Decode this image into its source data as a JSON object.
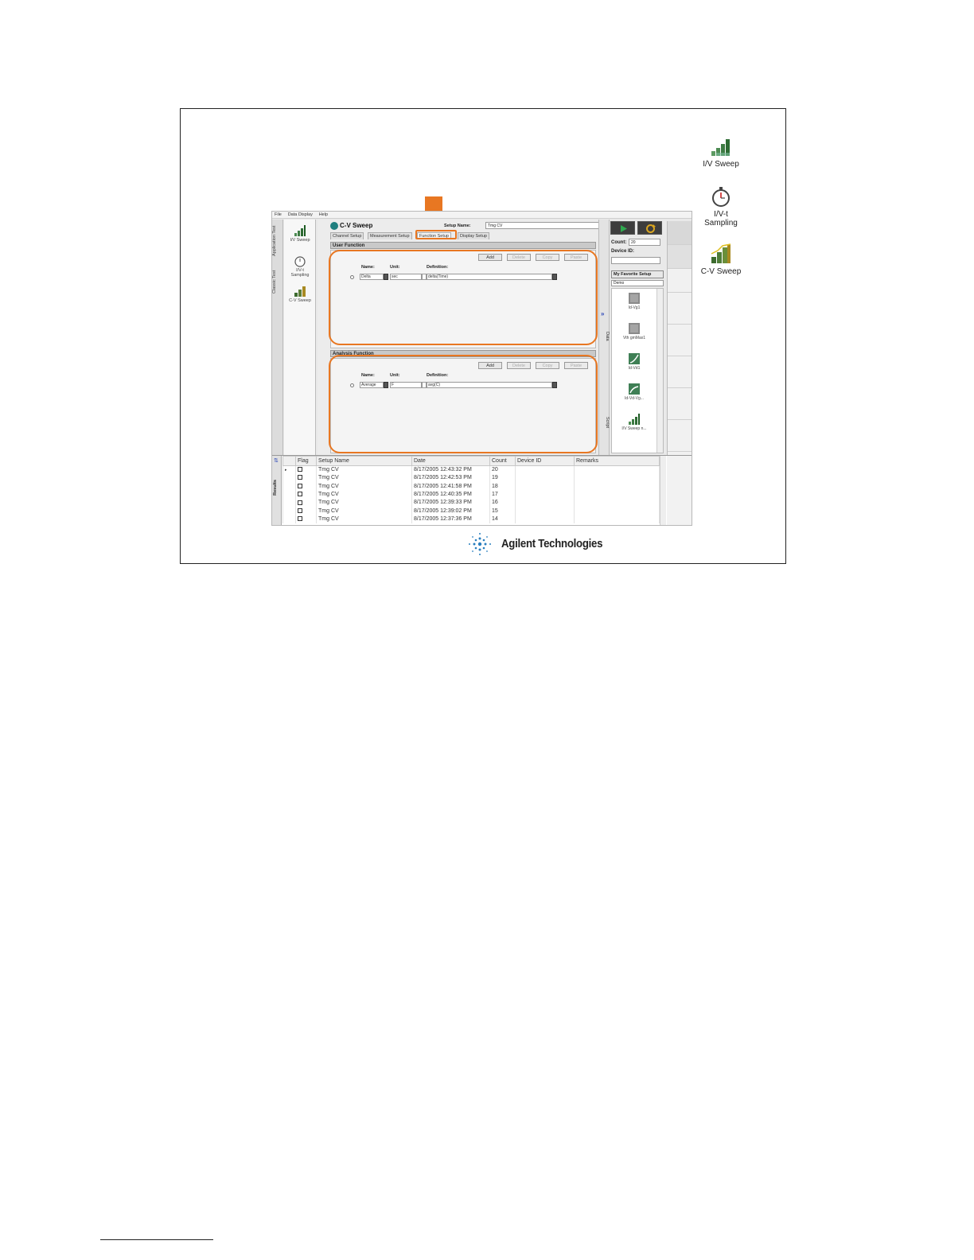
{
  "desktop_icons": [
    {
      "label": "I/V Sweep",
      "icon": "iv-sweep-icon"
    },
    {
      "label": "I/V-t Sampling",
      "icon": "stopwatch-icon"
    },
    {
      "label": "C-V Sweep",
      "icon": "cv-sweep-icon"
    }
  ],
  "menu": [
    "File",
    "Data Display",
    "Help"
  ],
  "vertical_tabs": [
    "Application Test",
    "Classic Test"
  ],
  "nav_items": [
    {
      "label": "I/V Sweep"
    },
    {
      "label": "I/V-t Sampling"
    },
    {
      "label": "C-V Sweep"
    }
  ],
  "header": {
    "title": "C-V Sweep",
    "setup_name_label": "Setup Name:",
    "setup_name_value": "Tmg CV"
  },
  "tabs": [
    {
      "label": "Channel Setup",
      "active": false
    },
    {
      "label": "Measurement Setup",
      "active": false
    },
    {
      "label": "Function Setup",
      "active": true
    },
    {
      "label": "Display Setup",
      "active": false
    }
  ],
  "user_function": {
    "header": "User Function",
    "buttons": [
      "Add",
      "Delete",
      "Copy",
      "Paste"
    ],
    "columns": {
      "name": "Name:",
      "unit": "Unit:",
      "definition": "Definition:"
    },
    "rows": [
      {
        "name": "Delta",
        "unit": "sec",
        "definition": "delta(Time)"
      }
    ]
  },
  "analysis_function": {
    "header": "Analysis Function",
    "buttons": [
      "Add",
      "Delete",
      "Copy",
      "Paste"
    ],
    "columns": {
      "name": "Name:",
      "unit": "Unit:",
      "definition": "Definition:"
    },
    "rows": [
      {
        "name": "Average",
        "unit": "F",
        "definition": "avg(C)"
      }
    ]
  },
  "side_tabs": [
    "Data",
    "Script"
  ],
  "rail": {
    "count_label": "Count:",
    "count_value": "20",
    "device_id_label": "Device ID:",
    "favorites_label": "My Favorite Setup",
    "favorites_selected": "Demo",
    "favorites": [
      "Id-Vg1",
      "Vth gmMax1",
      "Id-Vd1",
      "Id-Vd-Vg...",
      "I/V Sweep n..."
    ]
  },
  "results": {
    "side_label": "Results",
    "columns": [
      "Flag",
      "Setup Name",
      "Date",
      "Count",
      "Device ID",
      "Remarks"
    ],
    "rows": [
      {
        "setup": "Tmg CV",
        "date": "8/17/2005 12:43:32 PM",
        "count": "20"
      },
      {
        "setup": "Tmg CV",
        "date": "8/17/2005 12:42:53 PM",
        "count": "19"
      },
      {
        "setup": "Tmg CV",
        "date": "8/17/2005 12:41:58 PM",
        "count": "18"
      },
      {
        "setup": "Tmg CV",
        "date": "8/17/2005 12:40:35 PM",
        "count": "17"
      },
      {
        "setup": "Tmg CV",
        "date": "8/17/2005 12:39:33 PM",
        "count": "16"
      },
      {
        "setup": "Tmg CV",
        "date": "8/17/2005 12:39:02 PM",
        "count": "15"
      },
      {
        "setup": "Tmg CV",
        "date": "8/17/2005 12:37:36 PM",
        "count": "14"
      }
    ]
  },
  "logo_text": "Agilent Technologies",
  "colors": {
    "highlight": "#e87722",
    "run_green": "#2fa84f",
    "title_icon": "#1f7f7f"
  }
}
